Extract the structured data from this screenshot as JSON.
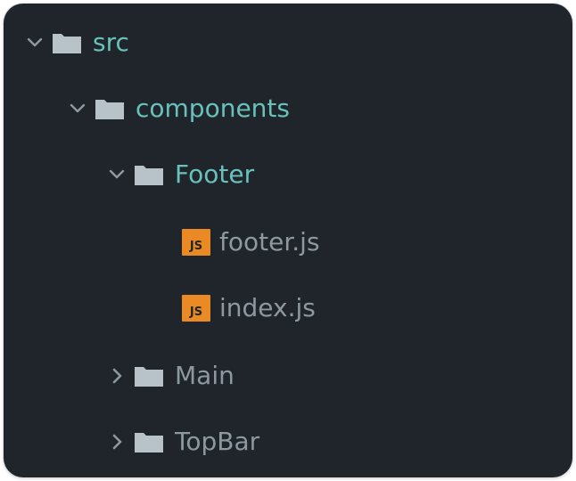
{
  "colors": {
    "background": "#1f252a",
    "folder_icon": "#b7c2c9",
    "open_folder_text": "#69c1bb",
    "closed_text": "#8d98a1",
    "js_badge": "#e98a25",
    "chevron": "#8d98a1"
  },
  "tree": {
    "rows": [
      {
        "label": "src",
        "type": "folder",
        "expanded": true,
        "icon": "folder-icon",
        "chevron": "chevron-down-icon"
      },
      {
        "label": "components",
        "type": "folder",
        "expanded": true,
        "icon": "folder-icon",
        "chevron": "chevron-down-icon"
      },
      {
        "label": "Footer",
        "type": "folder",
        "expanded": true,
        "icon": "folder-icon",
        "chevron": "chevron-down-icon"
      },
      {
        "label": "footer.js",
        "type": "file",
        "icon": "js-file-icon",
        "badge": "JS"
      },
      {
        "label": "index.js",
        "type": "file",
        "icon": "js-file-icon",
        "badge": "JS"
      },
      {
        "label": "Main",
        "type": "folder",
        "expanded": false,
        "icon": "folder-icon",
        "chevron": "chevron-right-icon"
      },
      {
        "label": "TopBar",
        "type": "folder",
        "expanded": false,
        "icon": "folder-icon",
        "chevron": "chevron-right-icon"
      }
    ]
  }
}
